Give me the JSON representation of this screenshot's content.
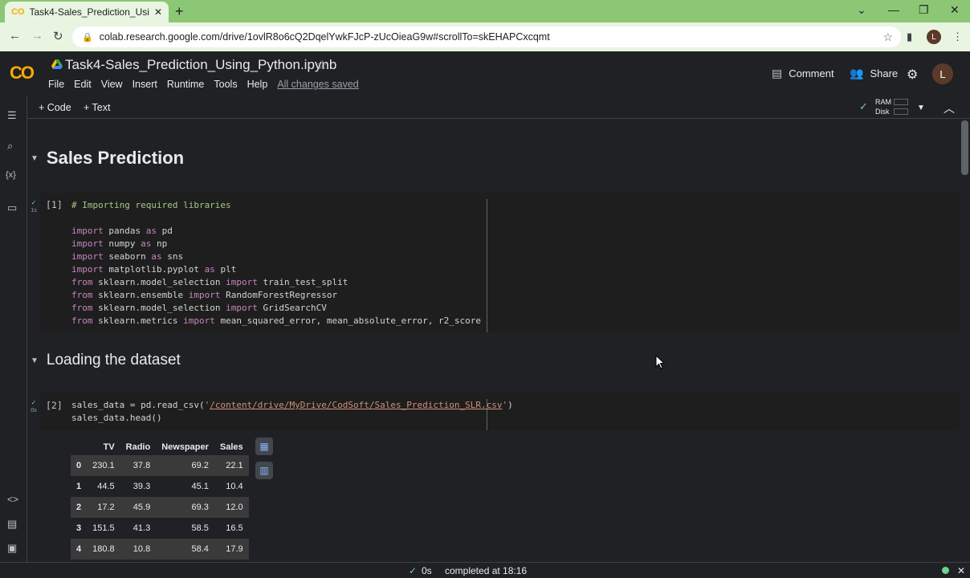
{
  "browser": {
    "tab_title": "Task4-Sales_Prediction_Using_Py",
    "tab_close": "✕",
    "new_tab": "+",
    "url": "colab.research.google.com/drive/1ovlR8o6cQ2DqelYwkFJcP-zUcOieaG9w#scrollTo=skEHAPCxcqmt",
    "profile_initial": "L"
  },
  "colab": {
    "logo": "CO",
    "notebook_title": "Task4-Sales_Prediction_Using_Python.ipynb",
    "menu": [
      "File",
      "Edit",
      "View",
      "Insert",
      "Runtime",
      "Tools",
      "Help"
    ],
    "save_status": "All changes saved",
    "comment_label": "Comment",
    "share_label": "Share",
    "avatar_initial": "L"
  },
  "toolbar": {
    "code_label": "+ Code",
    "text_label": "+ Text",
    "ram_label": "RAM",
    "disk_label": "Disk"
  },
  "sections": {
    "title1": "Sales Prediction",
    "title2": "Loading the dataset"
  },
  "cell1": {
    "number": "[1]",
    "run_time": "1s",
    "comment": "# Importing required libraries"
  },
  "cell2": {
    "number": "[2]",
    "run_time": "0s",
    "line1_prefix": "sales_data = pd.read_csv(",
    "line1_quote_open": "'",
    "line1_path": "/content/drive/MyDrive/CodSoft/Sales_Prediction_SLR.csv",
    "line1_quote_close": "'",
    "line1_suffix": ")",
    "line2": "sales_data.head()"
  },
  "dataframe": {
    "columns": [
      "",
      "TV",
      "Radio",
      "Newspaper",
      "Sales"
    ],
    "rows": [
      [
        "0",
        "230.1",
        "37.8",
        "69.2",
        "22.1"
      ],
      [
        "1",
        "44.5",
        "39.3",
        "45.1",
        "10.4"
      ],
      [
        "2",
        "17.2",
        "45.9",
        "69.3",
        "12.0"
      ],
      [
        "3",
        "151.5",
        "41.3",
        "58.5",
        "16.5"
      ],
      [
        "4",
        "180.8",
        "10.8",
        "58.4",
        "17.9"
      ]
    ]
  },
  "status": {
    "check": "✓",
    "time": "0s",
    "message": "completed at 18:16"
  },
  "colors": {
    "accent_green": "#6dd58c",
    "logo_orange": "#f9ab00",
    "tab_bar": "#8cc776"
  }
}
